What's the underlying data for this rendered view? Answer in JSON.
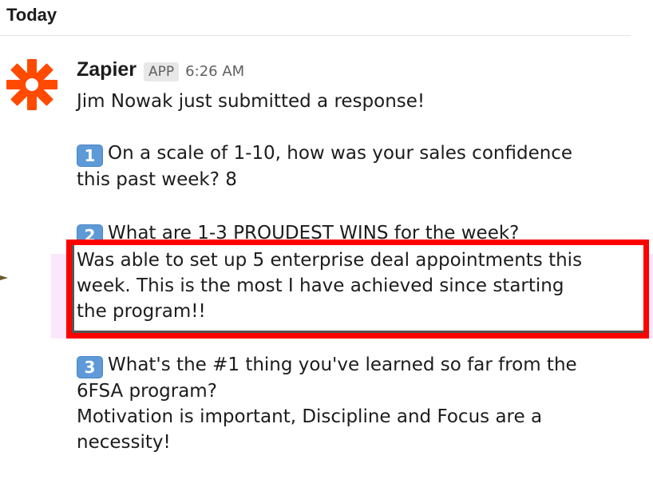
{
  "day_header": "Today",
  "message": {
    "sender": "Zapier",
    "badge": "APP",
    "timestamp": "6:26 AM",
    "intro": "Jim Nowak just submitted a response!",
    "questions": [
      {
        "number": "1",
        "line1": "On a scale of 1-10, how was your sales confidence",
        "line2": "this past week? 8"
      },
      {
        "number": "2",
        "text": "What are 1-3 PROUDEST WINS for the week?",
        "answer_lines": [
          "Was able to set up 5 enterprise deal appointments this",
          "week.  This is the most I have achieved since starting",
          "the program!!"
        ]
      },
      {
        "number": "3",
        "line1": "What's the #1 thing you've learned so far from the",
        "line2": "6FSA program?",
        "answer_lines": [
          "Motivation is important, Discipline and Focus are a",
          "necessity!"
        ]
      }
    ]
  },
  "colors": {
    "zapier_orange": "#ff4a00",
    "highlight_red": "#ff0000",
    "keycap_blue": "#5d9ad7"
  },
  "icons": {
    "avatar": "zapier-asterisk-logo"
  }
}
